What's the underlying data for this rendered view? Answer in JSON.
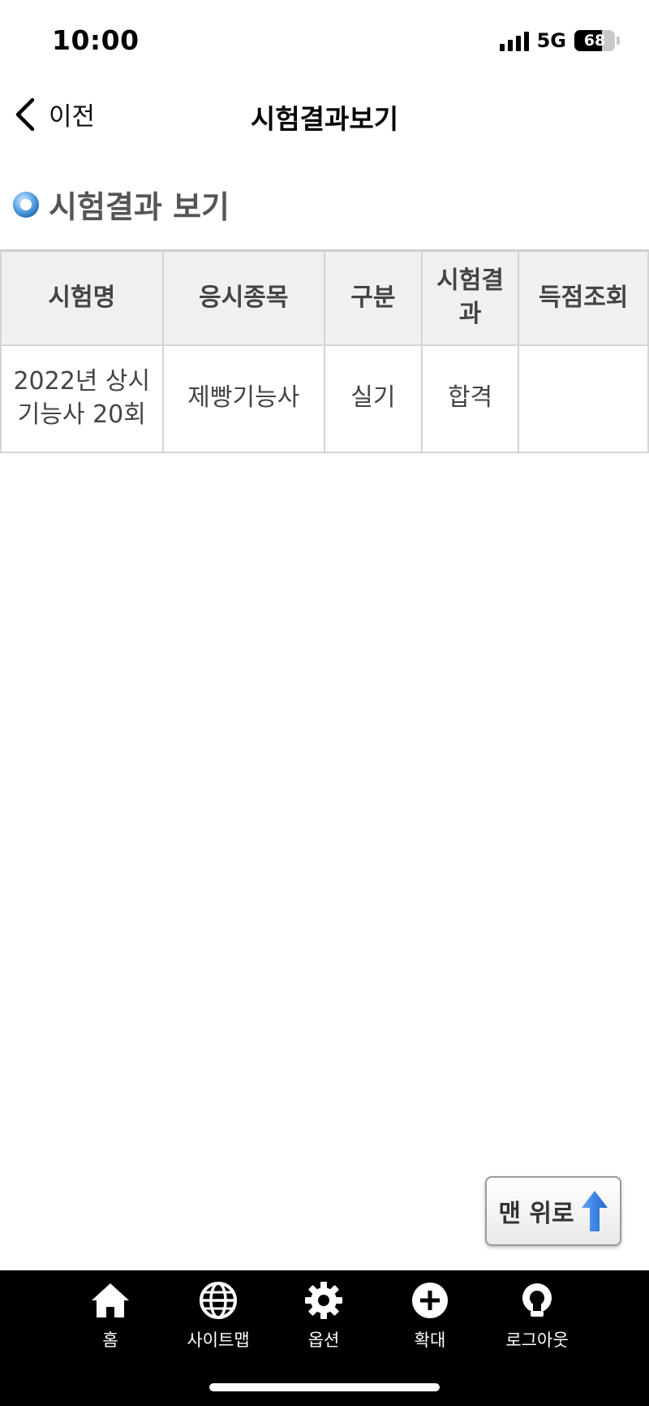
{
  "status_bar": {
    "time": "10:00",
    "network": "5G",
    "battery": "68"
  },
  "nav": {
    "back_label": "이전",
    "title": "시험결과보기"
  },
  "section": {
    "title": "시험결과 보기"
  },
  "table": {
    "headers": [
      "시험명",
      "응시종목",
      "구분",
      "시험결과",
      "득점조회"
    ],
    "rows": [
      [
        "2022년 상시 기능사 20회",
        "제빵기능사",
        "실기",
        "합격",
        ""
      ]
    ]
  },
  "top_button": {
    "label": "맨 위로"
  },
  "toolbar": {
    "items": [
      {
        "label": "홈",
        "icon": "home-icon"
      },
      {
        "label": "사이트맵",
        "icon": "globe-icon"
      },
      {
        "label": "옵션",
        "icon": "gear-icon"
      },
      {
        "label": "확대",
        "icon": "plus-circle-icon"
      },
      {
        "label": "로그아웃",
        "icon": "logout-icon"
      }
    ]
  },
  "colors": {
    "toolbar_bg": "#000000",
    "header_bg": "#f0f0f0",
    "border": "#d4d4d4",
    "accent_arrow": "#2f7de1"
  }
}
